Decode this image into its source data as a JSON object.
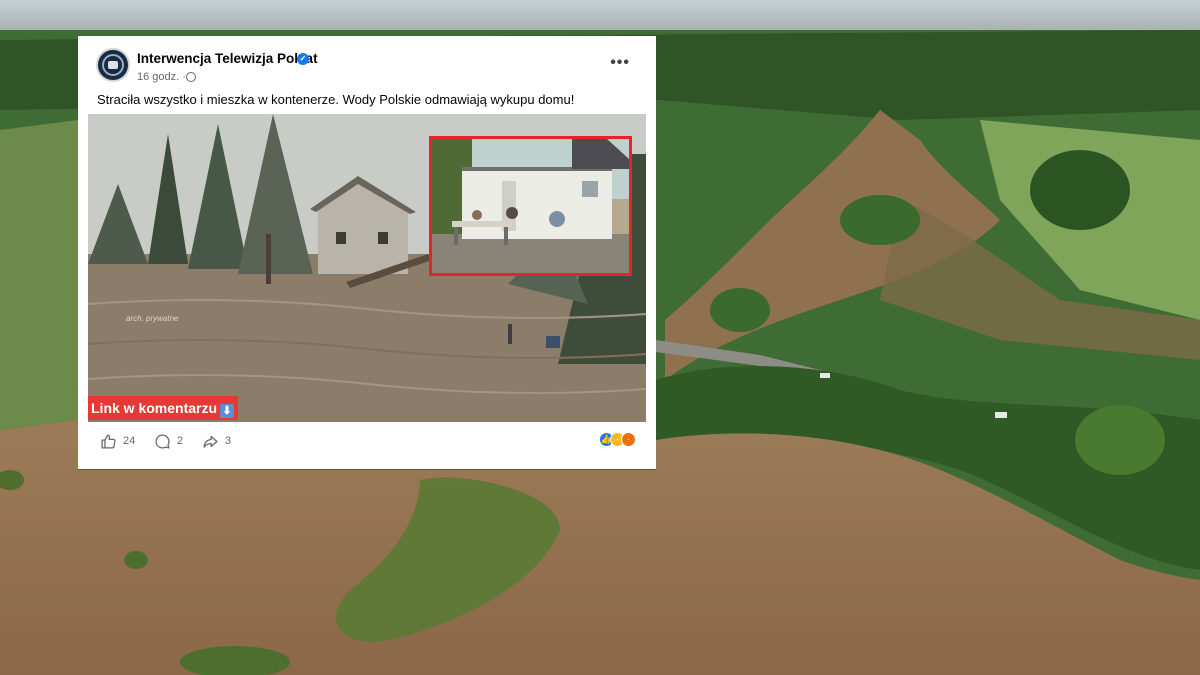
{
  "post": {
    "page_name": "Interwencja Telewizja Polsat",
    "time": "16 godz. ·",
    "text": "Straciła wszystko i mieszka w kontenerze. Wody Polskie odmawiają wykupu domu!",
    "photo_watermark": "arch. prywatne",
    "link_banner": "Link w komentarzu",
    "more_label": "•••"
  },
  "stats": {
    "likes": "24",
    "comments": "2",
    "shares": "3"
  },
  "icons": {
    "verified": "verified-badge-icon",
    "globe": "globe-icon",
    "like": "thumbs-up-icon",
    "comment": "comment-bubble-icon",
    "share": "share-arrow-icon",
    "down_arrow": "down-arrow-icon"
  },
  "colors": {
    "facebook_blue": "#1877f2",
    "banner_red": "#e53935",
    "inset_border": "#e3242b"
  }
}
